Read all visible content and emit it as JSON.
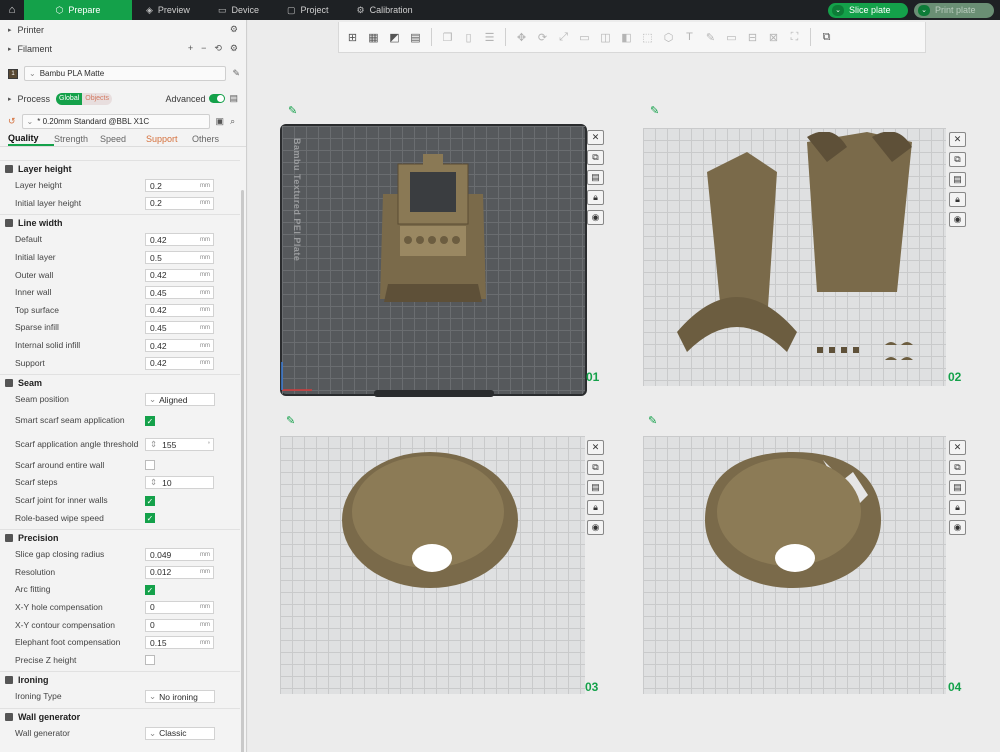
{
  "topbar": {
    "tabs": [
      {
        "label": "Prepare",
        "icon": "cube-icon"
      },
      {
        "label": "Preview",
        "icon": "preview-icon"
      },
      {
        "label": "Device",
        "icon": "device-icon"
      },
      {
        "label": "Project",
        "icon": "project-icon"
      },
      {
        "label": "Calibration",
        "icon": "calibration-icon"
      }
    ],
    "slice_label": "Slice plate",
    "print_label": "Print plate"
  },
  "panel": {
    "printer_label": "Printer",
    "filament_label": "Filament",
    "filament_value": "Bambu PLA Matte",
    "filament_slot": "1",
    "process_label": "Process",
    "global_label": "Global",
    "objects_label": "Objects",
    "advanced_label": "Advanced",
    "preset_value": "* 0.20mm Standard @BBL X1C",
    "tabs": [
      "Quality",
      "Strength",
      "Speed",
      "Support",
      "Others"
    ]
  },
  "settings": {
    "layer_height": {
      "title": "Layer height",
      "rows": [
        {
          "label": "Layer height",
          "value": "0.2",
          "unit": "mm"
        },
        {
          "label": "Initial layer height",
          "value": "0.2",
          "unit": "mm"
        }
      ]
    },
    "line_width": {
      "title": "Line width",
      "rows": [
        {
          "label": "Default",
          "value": "0.42",
          "unit": "mm"
        },
        {
          "label": "Initial layer",
          "value": "0.5",
          "unit": "mm"
        },
        {
          "label": "Outer wall",
          "value": "0.42",
          "unit": "mm"
        },
        {
          "label": "Inner wall",
          "value": "0.45",
          "unit": "mm"
        },
        {
          "label": "Top surface",
          "value": "0.42",
          "unit": "mm"
        },
        {
          "label": "Sparse infill",
          "value": "0.45",
          "unit": "mm"
        },
        {
          "label": "Internal solid infill",
          "value": "0.42",
          "unit": "mm"
        },
        {
          "label": "Support",
          "value": "0.42",
          "unit": "mm"
        }
      ]
    },
    "seam": {
      "title": "Seam",
      "seam_position_label": "Seam position",
      "seam_position_value": "Aligned",
      "smart_scarf_label": "Smart scarf seam application",
      "scarf_angle_label": "Scarf application angle threshold",
      "scarf_angle_value": "155",
      "scarf_angle_unit": "°",
      "scarf_entire_label": "Scarf around entire wall",
      "scarf_steps_label": "Scarf steps",
      "scarf_steps_value": "10",
      "scarf_inner_label": "Scarf joint for inner walls",
      "role_wipe_label": "Role-based wipe speed"
    },
    "precision": {
      "title": "Precision",
      "rows": [
        {
          "label": "Slice gap closing radius",
          "value": "0.049",
          "unit": "mm"
        },
        {
          "label": "Resolution",
          "value": "0.012",
          "unit": "mm"
        }
      ],
      "arc_label": "Arc fitting",
      "rows2": [
        {
          "label": "X-Y hole compensation",
          "value": "0",
          "unit": "mm"
        },
        {
          "label": "X-Y contour compensation",
          "value": "0",
          "unit": "mm"
        },
        {
          "label": "Elephant foot compensation",
          "value": "0.15",
          "unit": "mm"
        }
      ],
      "precise_z_label": "Precise Z height"
    },
    "ironing": {
      "title": "Ironing",
      "type_label": "Ironing Type",
      "type_value": "No ironing"
    },
    "wall_generator": {
      "title": "Wall generator",
      "label": "Wall generator",
      "value": "Classic"
    }
  },
  "plates": [
    {
      "number": "01",
      "name": "Bambu Textured PEI Plate"
    },
    {
      "number": "02"
    },
    {
      "number": "03"
    },
    {
      "number": "04"
    }
  ],
  "colors": {
    "accent": "#14a14a",
    "model": "#7a6a4a",
    "warning": "#d5703c"
  }
}
